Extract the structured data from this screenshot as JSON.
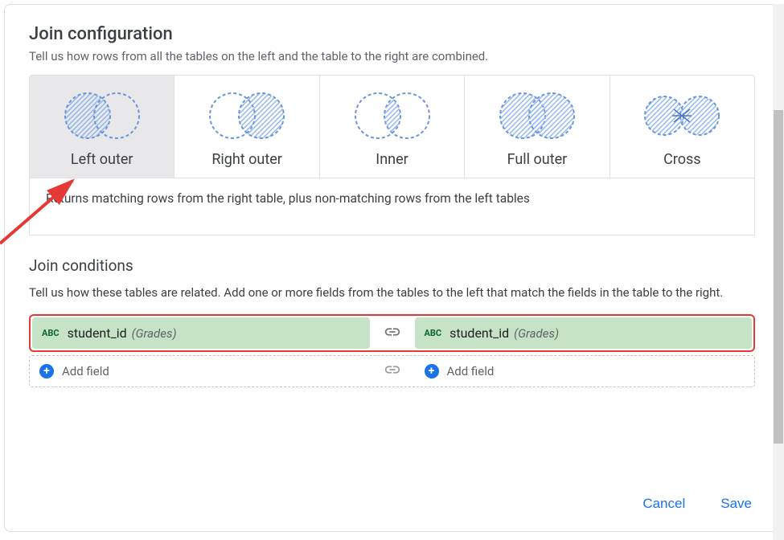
{
  "header": {
    "title": "Join configuration",
    "subtitle": "Tell us how rows from all the tables on the left and the table to the right are combined."
  },
  "joinTypes": {
    "items": [
      {
        "label": "Left outer",
        "selected": true
      },
      {
        "label": "Right outer",
        "selected": false
      },
      {
        "label": "Inner",
        "selected": false
      },
      {
        "label": "Full outer",
        "selected": false
      },
      {
        "label": "Cross",
        "selected": false
      }
    ],
    "selectedDescription": "Returns matching rows from the right table, plus non-matching rows from the left tables"
  },
  "conditions": {
    "title": "Join conditions",
    "subtitle": "Tell us how these tables are related. Add one or more fields from the tables to the left that match the fields in the table to the right.",
    "rows": [
      {
        "left": {
          "type": "ABC",
          "name": "student_id",
          "source": "(Grades)"
        },
        "right": {
          "type": "ABC",
          "name": "student_id",
          "source": "(Grades)"
        }
      }
    ],
    "addLabel": "Add field"
  },
  "actions": {
    "cancel": "Cancel",
    "save": "Save"
  }
}
